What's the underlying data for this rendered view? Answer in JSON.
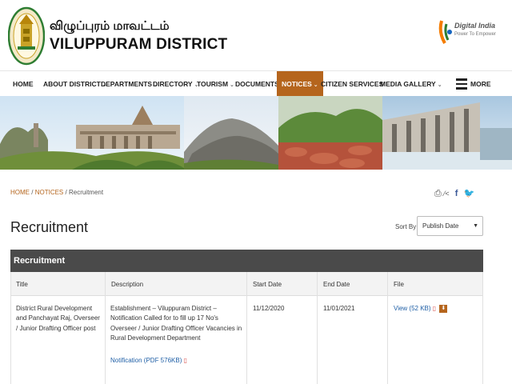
{
  "header": {
    "title_tamil": "விழுப்புரம் மாவட்டம்",
    "title_english": "VILUPPURAM DISTRICT",
    "digital_india_line1": "Digital India",
    "digital_india_line2": "Power To Empower"
  },
  "nav": {
    "items": [
      {
        "label": "HOME",
        "has_menu": false
      },
      {
        "label": "ABOUT DISTRICT",
        "has_menu": true
      },
      {
        "label": "DEPARTMENTS",
        "has_menu": true
      },
      {
        "label": "DIRECTORY",
        "has_menu": true
      },
      {
        "label": "TOURISM",
        "has_menu": true
      },
      {
        "label": "DOCUMENTS",
        "has_menu": true
      },
      {
        "label": "NOTICES",
        "has_menu": true,
        "active": true
      },
      {
        "label": "CITIZEN SERVICES",
        "has_menu": false
      },
      {
        "label": "MEDIA GALLERY",
        "has_menu": true
      }
    ],
    "more_label": "MORE",
    "chevron": "⌄"
  },
  "breadcrumb": {
    "home": "HOME",
    "sep": "/",
    "notices": "NOTICES",
    "current": "Recruitment"
  },
  "page": {
    "title": "Recruitment",
    "sort_label": "Sort By:",
    "sort_value": "Publish Date"
  },
  "table": {
    "caption": "Recruitment",
    "headers": [
      "Title",
      "Description",
      "Start Date",
      "End Date",
      "File"
    ],
    "rows": [
      {
        "title": "District Rural Development and Panchayat Raj, Overseer / Junior Drafting Officer post",
        "description": "Establishment – Viluppuram District – Notification Called for to fill up 17 No's Overseer / Junior Drafting Officer  Vacancies in Rural Development Department",
        "notification_link": "Notification (PDF 576KB)",
        "start_date": "11/12/2020",
        "end_date": "11/01/2021",
        "file_link": "View (52 KB)"
      }
    ]
  },
  "colors": {
    "accent": "#b5651d",
    "table_header": "#4a4a4a",
    "link": "#1f5fa6"
  }
}
